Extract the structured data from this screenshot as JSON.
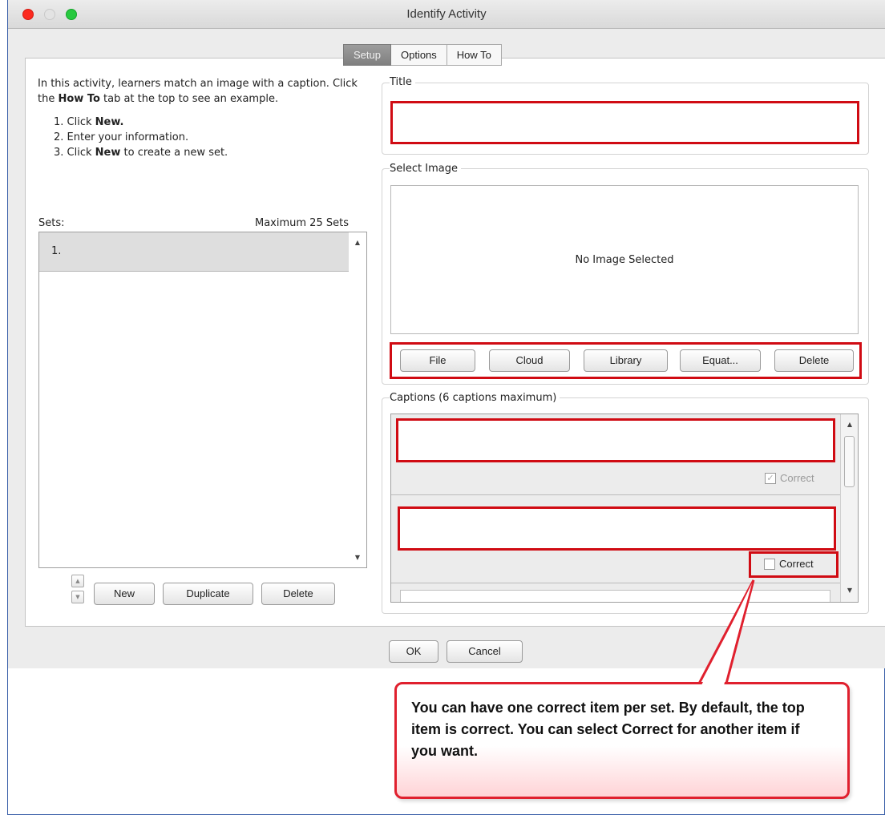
{
  "window": {
    "title": "Identify Activity"
  },
  "tabs": [
    {
      "label": "Setup",
      "active": true
    },
    {
      "label": "Options",
      "active": false
    },
    {
      "label": "How To",
      "active": false
    }
  ],
  "instructions": {
    "intro_1": "In this activity, learners match an image with a caption. Click the ",
    "intro_bold": "How To",
    "intro_2": " tab at the top to see an example.",
    "steps": [
      {
        "pre": "1. Click ",
        "bold": "New.",
        "post": ""
      },
      {
        "pre": "2. Enter your information.",
        "bold": "",
        "post": ""
      },
      {
        "pre": "3. Click ",
        "bold": "New",
        "post": " to create a new set."
      }
    ]
  },
  "sets": {
    "label": "Sets:",
    "max_label": "Maximum 25 Sets",
    "items": [
      "1."
    ],
    "buttons": {
      "new": "New",
      "duplicate": "Duplicate",
      "delete": "Delete"
    }
  },
  "title_group": {
    "label": "Title",
    "value": ""
  },
  "image_group": {
    "label": "Select Image",
    "placeholder": "No Image Selected",
    "buttons": [
      "File",
      "Cloud",
      "Library",
      "Equat...",
      "Delete"
    ]
  },
  "captions_group": {
    "label": "Captions (6 captions maximum)",
    "items": [
      {
        "value": "",
        "correct_label": "Correct",
        "checked": true,
        "disabled": true
      },
      {
        "value": "",
        "correct_label": "Correct",
        "checked": false,
        "disabled": false
      }
    ]
  },
  "dialog_buttons": {
    "ok": "OK",
    "cancel": "Cancel"
  },
  "callout": {
    "text": "You can have one correct item per set. By default, the top item is correct. You can select Correct for another item if you want."
  },
  "colors": {
    "highlight": "#d00b13",
    "callout_border": "#e0202e",
    "frame_border": "#3a5fa8"
  }
}
